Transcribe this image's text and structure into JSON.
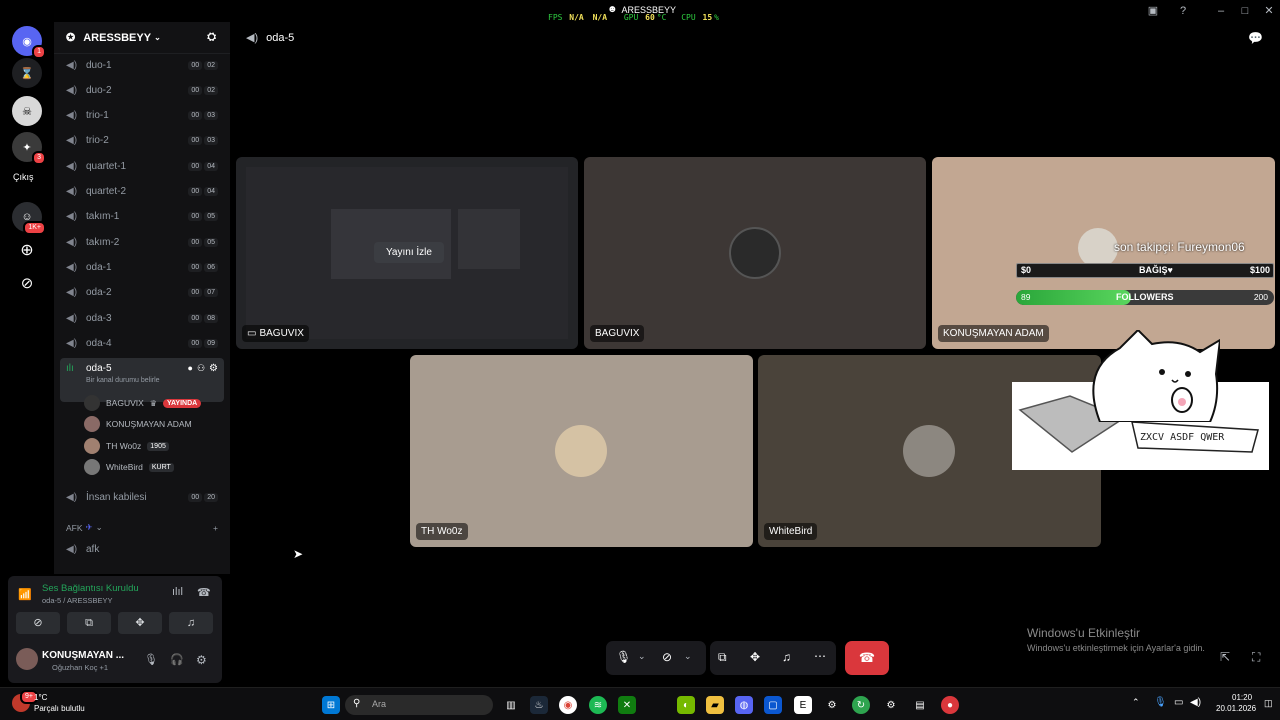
{
  "topbar": {
    "fps_label": "FPS",
    "fps_value": "N/A",
    "fps_value2": "N/A",
    "gpu_label": "GPU",
    "gpu_value": "60",
    "gpu_unit": "°C",
    "cpu_label": "CPU",
    "cpu_value": "15",
    "cpu_unit": "%",
    "window_title": "ARESSBEYY"
  },
  "rail": {
    "badge_1": "1",
    "badge_3": "3",
    "cikis_label": "Çıkış",
    "badge_1k": "1K+"
  },
  "server": {
    "name": "ARESSBEYY"
  },
  "channels": [
    {
      "name": "duo-1",
      "c1": "00",
      "c2": "02"
    },
    {
      "name": "duo-2",
      "c1": "00",
      "c2": "02"
    },
    {
      "name": "trio-1",
      "c1": "00",
      "c2": "03"
    },
    {
      "name": "trio-2",
      "c1": "00",
      "c2": "03"
    },
    {
      "name": "quartet-1",
      "c1": "00",
      "c2": "04"
    },
    {
      "name": "quartet-2",
      "c1": "00",
      "c2": "04"
    },
    {
      "name": "takım-1",
      "c1": "00",
      "c2": "05"
    },
    {
      "name": "takım-2",
      "c1": "00",
      "c2": "05"
    },
    {
      "name": "oda-1",
      "c1": "00",
      "c2": "06"
    },
    {
      "name": "oda-2",
      "c1": "00",
      "c2": "07"
    },
    {
      "name": "oda-3",
      "c1": "00",
      "c2": "08"
    },
    {
      "name": "oda-4",
      "c1": "00",
      "c2": "09"
    }
  ],
  "active_channel": {
    "name": "oda-5",
    "status": "Bir kanal durumu belirle"
  },
  "members": [
    {
      "name": "BAGUVIX",
      "tag": "YAYINDA"
    },
    {
      "name": "KONUŞMAYAN ADAM"
    },
    {
      "name": "TH Wo0z",
      "tag": "1905"
    },
    {
      "name": "WhiteBird",
      "tag": "KURT"
    }
  ],
  "extra_channel": {
    "name": "İnsan kabilesi",
    "c1": "00",
    "c2": "20"
  },
  "afk_category": "AFK",
  "afk_channel": "afk",
  "voice_panel": {
    "status": "Ses Bağlantısı Kuruldu",
    "location": "oda-5 / ARESSBEYY",
    "user_name": "KONUŞMAYAN ...",
    "user_sub": "Oğuzhan Koç +1"
  },
  "main": {
    "channel_title": "oda-5"
  },
  "tiles": {
    "stream": {
      "label": "BAGUVIX",
      "button": "Yayını İzle"
    },
    "t2": {
      "label": "BAGUVIX"
    },
    "t3": {
      "label": "KONUŞMAYAN ADAM"
    },
    "t4": {
      "label": "TH Wo0z"
    },
    "t5": {
      "label": "WhiteBird"
    }
  },
  "overlay": {
    "follower_text": "son takipçi: Fureymon06",
    "donate_left": "$0",
    "donate_label": "BAĞIŞ♥",
    "donate_right": "$100",
    "follow_left": "89",
    "follow_label": "FOLLOWERS",
    "follow_right": "200",
    "follow_progress": 0.445,
    "keyboard_text": "ZXCV ASDF QWER"
  },
  "activate_windows": {
    "title": "Windows'u Etkinleştir",
    "subtitle": "Windows'u etkinleştirmek için Ayarlar'a gidin."
  },
  "taskbar": {
    "weather_temp": "1°C",
    "weather_text": "Parçalı bulutlu",
    "weather_badge": "9+",
    "search_placeholder": "Ara",
    "time": "01:20",
    "date": "20.01.2026"
  }
}
